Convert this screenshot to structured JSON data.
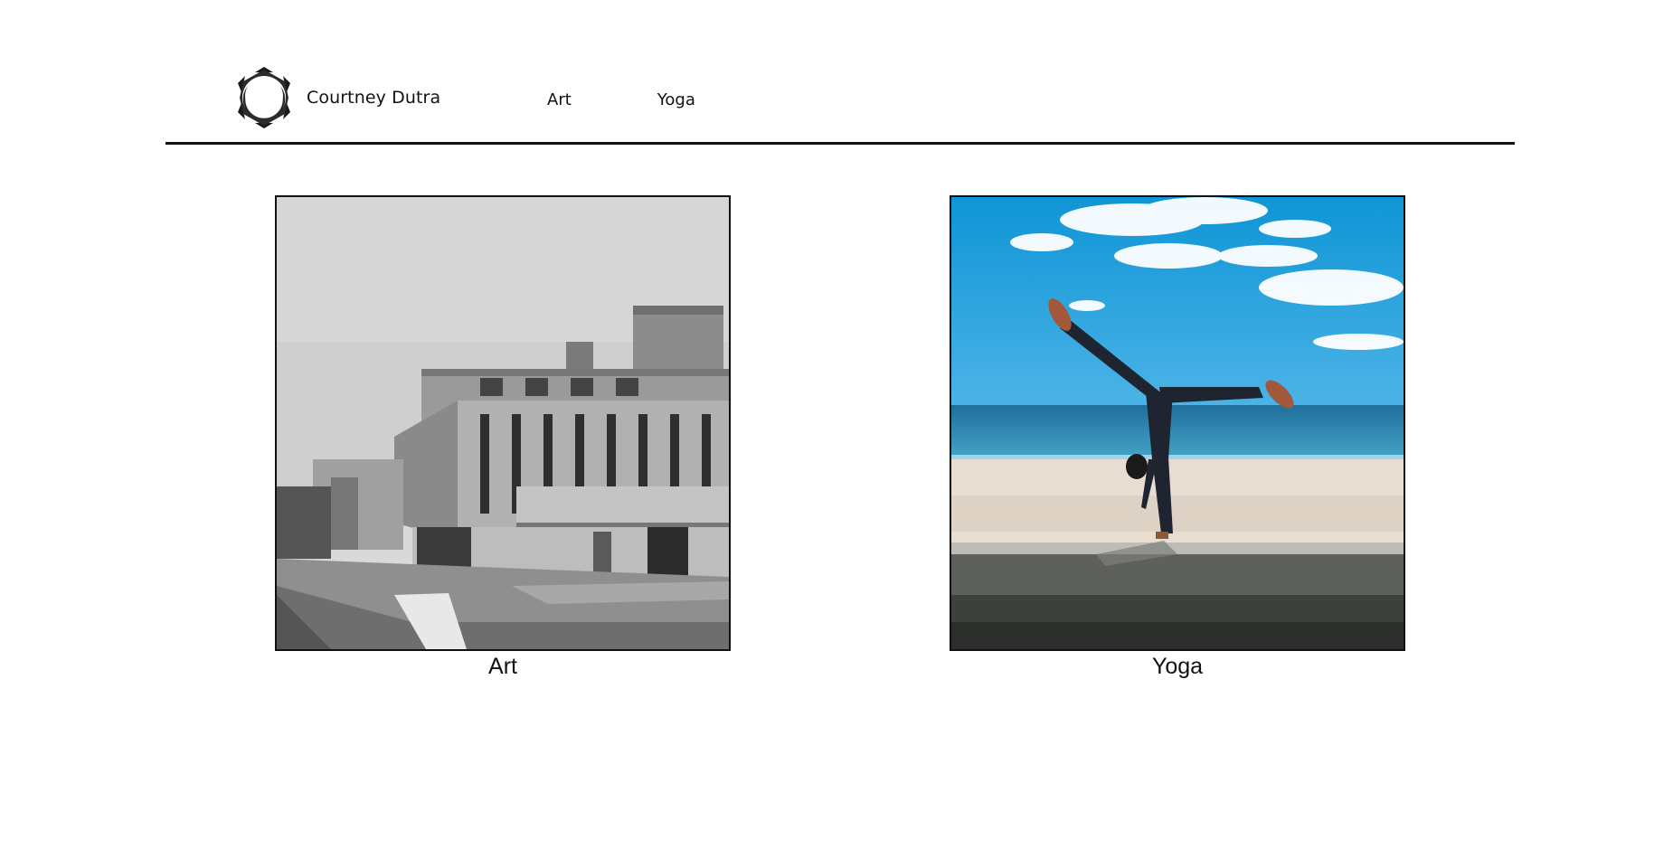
{
  "header": {
    "brand_name": "Courtney Dutra",
    "logo_icon": "lotus-ring-logo-icon",
    "nav": [
      {
        "label": "Art"
      },
      {
        "label": "Yoga"
      }
    ]
  },
  "cards": [
    {
      "caption": "Art",
      "image": "grayscale-painting-of-concrete-building"
    },
    {
      "caption": "Yoga",
      "image": "handstand-splits-on-beach-seawall"
    }
  ],
  "colors": {
    "text": "#111111",
    "background": "#ffffff",
    "divider": "#111111",
    "sky": "#1e9fd8",
    "sea": "#2a86b8",
    "sand": "#e6dcd0"
  }
}
